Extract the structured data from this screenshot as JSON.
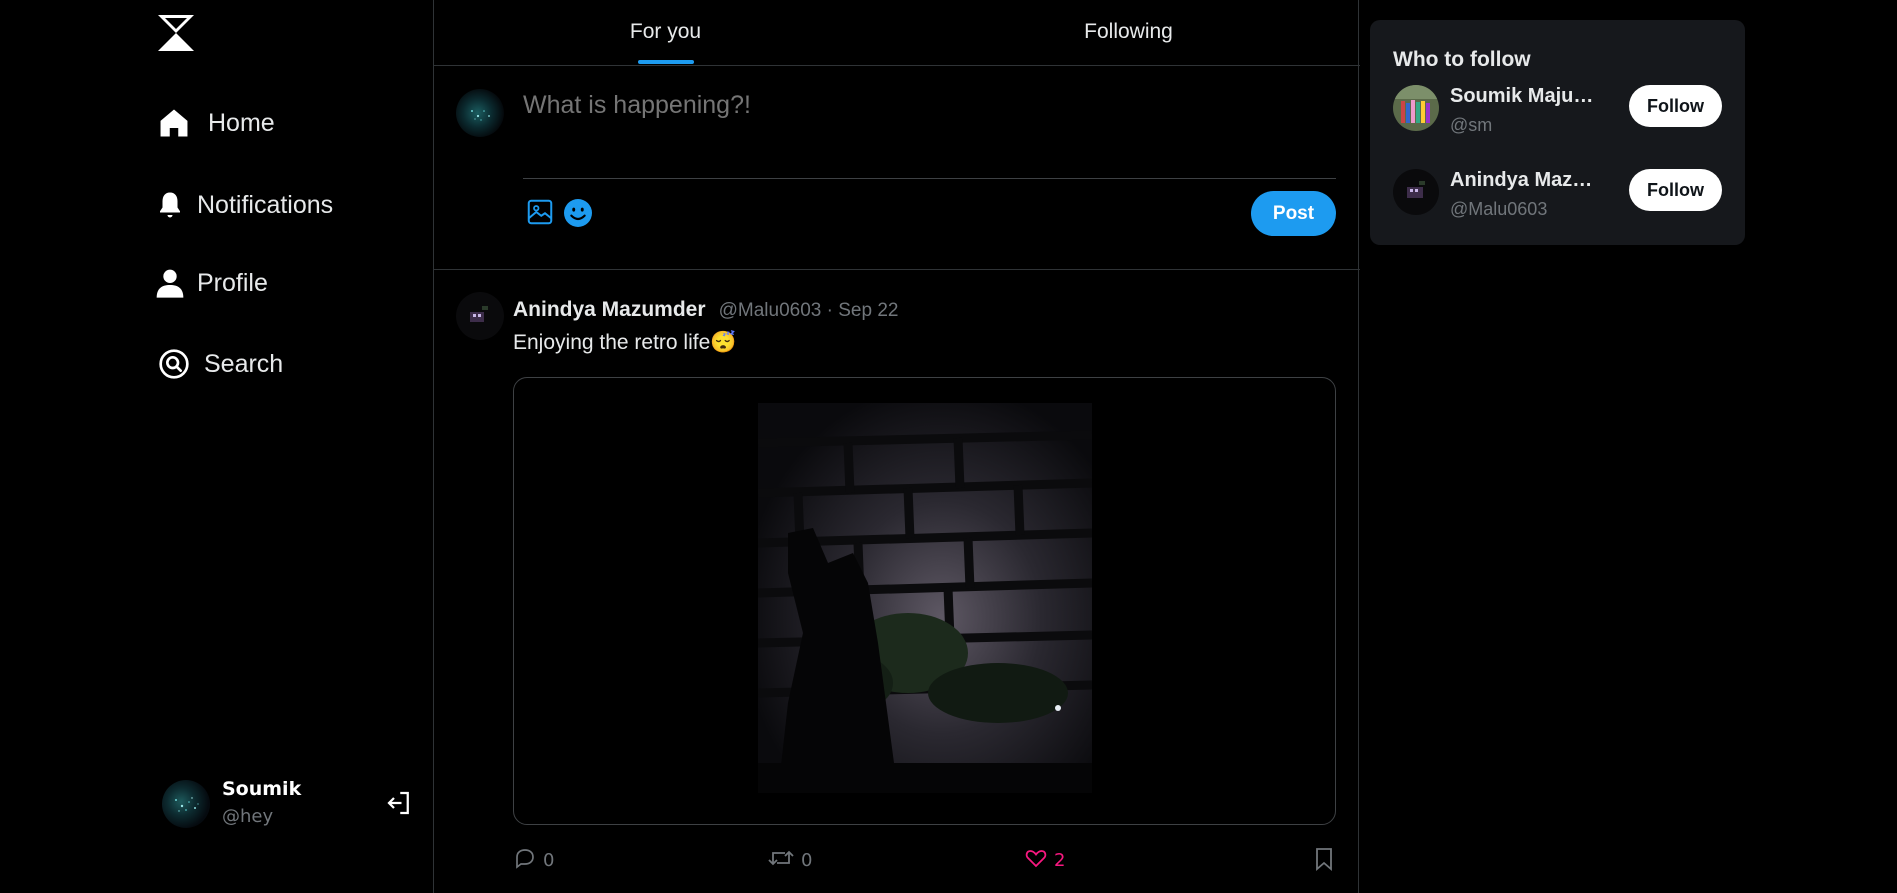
{
  "app": {
    "logo_icon": "hourglass-logo-icon"
  },
  "nav": {
    "items": [
      {
        "label": "Home",
        "icon": "home-icon"
      },
      {
        "label": "Notifications",
        "icon": "bell-icon"
      },
      {
        "label": "Profile",
        "icon": "user-icon"
      },
      {
        "label": "Search",
        "icon": "search-icon"
      }
    ]
  },
  "current_user": {
    "name": "Soumik",
    "handle": "@hey",
    "logout_icon": "logout-icon"
  },
  "tabs": [
    {
      "label": "For you",
      "active": true
    },
    {
      "label": "Following",
      "active": false
    }
  ],
  "composer": {
    "placeholder": "What is happening?!",
    "image_icon": "image-icon",
    "emoji_icon": "emoji-icon",
    "post_label": "Post"
  },
  "tweet": {
    "author": "Anindya Mazumder",
    "meta": "@Malu0603 · Sep 22",
    "text": "Enjoying the retro life😴",
    "actions": {
      "replies": "0",
      "retweets": "0",
      "likes": "2"
    },
    "accent_like": "#f91880"
  },
  "who_to_follow": {
    "title": "Who to follow",
    "users": [
      {
        "name": "Soumik Majumder",
        "handle": "@sm",
        "button": "Follow"
      },
      {
        "name": "Anindya Mazumder",
        "handle": "@Malu0603",
        "button": "Follow"
      }
    ]
  },
  "colors": {
    "accent": "#1d9bf0",
    "background": "#000000",
    "panel": "#16181c"
  }
}
